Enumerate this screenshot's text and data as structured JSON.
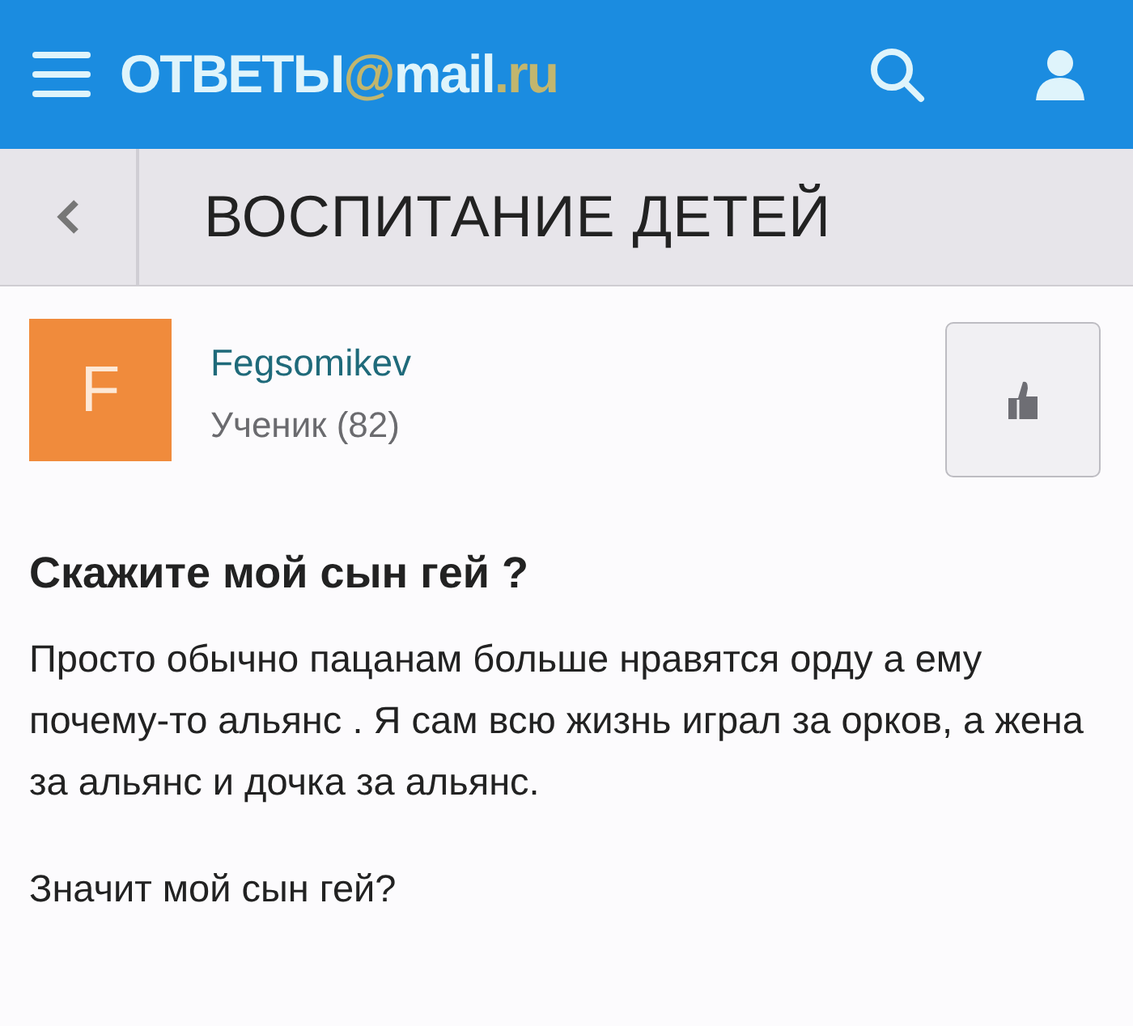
{
  "header": {
    "logo": [
      {
        "text": "ОТВЕТЫ",
        "kind": "plain"
      },
      {
        "text": "@",
        "kind": "accent"
      },
      {
        "text": "mail",
        "kind": "plain"
      },
      {
        "text": ".ru",
        "kind": "accent"
      }
    ]
  },
  "category": {
    "title": "ВОСПИТАНИЕ ДЕТЕЙ"
  },
  "author": {
    "avatar_letter": "F",
    "name": "Fegsomikev",
    "rank": "Ученик (82)"
  },
  "question": {
    "title": "Скажите мой сын гей ?",
    "paragraphs": [
      "Просто обычно пацанам больше нравятся орду а ему почему-то  альянс . Я сам всю жизнь играл за орков, а жена за  альянс и дочка за альянс.",
      "Значит мой сын гей?"
    ]
  }
}
